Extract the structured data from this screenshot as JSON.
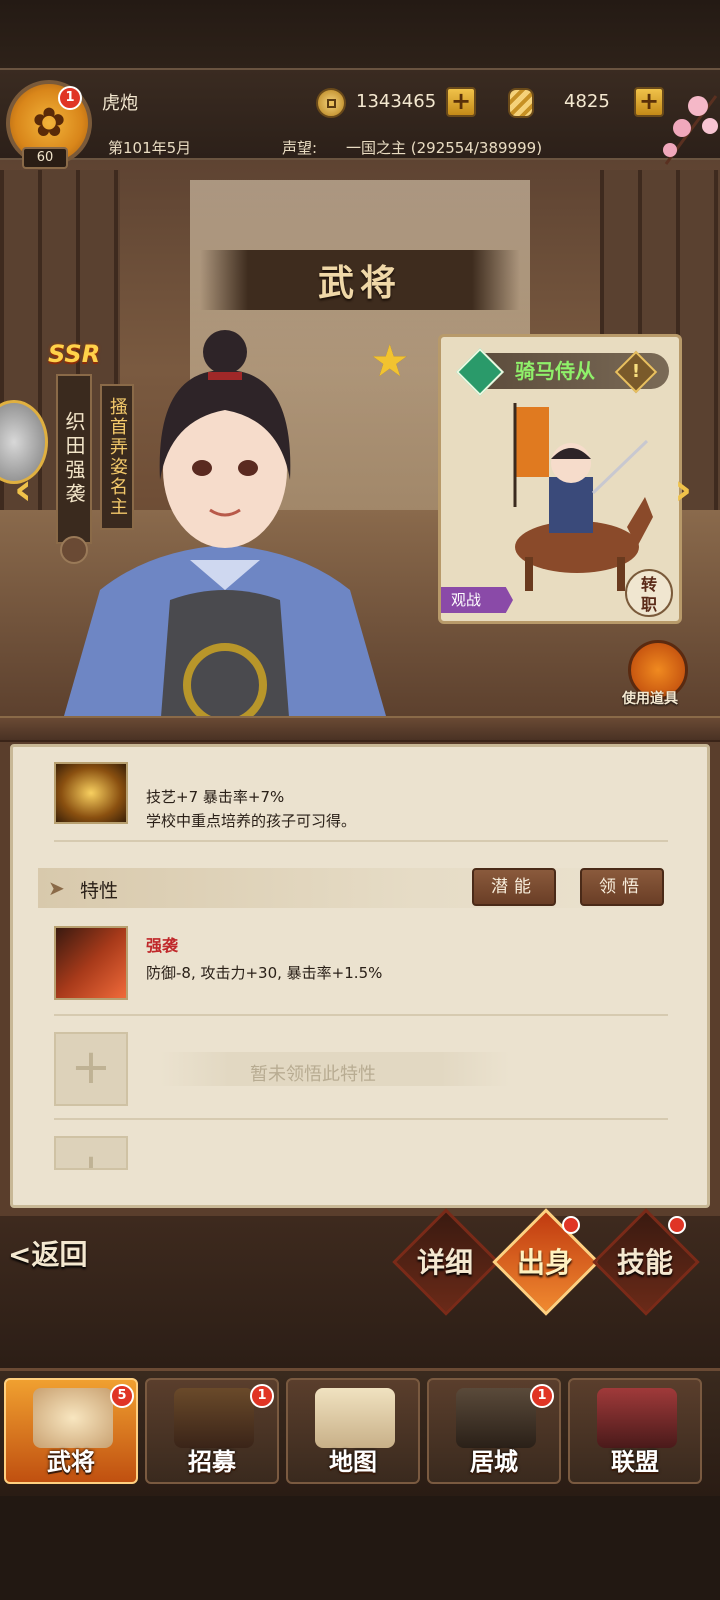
{
  "player": {
    "name": "虎炮",
    "level": "60",
    "notification_count": "1",
    "date": "第101年5月",
    "reputation_label": "声望:",
    "reputation_value": "一国之主 (292554/389999)"
  },
  "currency": {
    "copper": "1343465",
    "gold": "4825"
  },
  "page_title": "武将",
  "general": {
    "rarity": "SSR",
    "name": "织田强袭",
    "title": "搔首弄姿名主"
  },
  "unit": {
    "name": "骑马侍从",
    "spectate_tag": "观战",
    "transfer_label": "转职"
  },
  "use_item_label": "使用道具",
  "skill": {
    "stats": "技艺+7  暴击率+7%",
    "description": "学校中重点培养的孩子可习得。"
  },
  "traits": {
    "section_label": "特性",
    "potential_button": "潜能",
    "comprehend_button": "领悟",
    "items": [
      {
        "name": "强袭",
        "effect": "防御-8, 攻击力+30, 暴击率+1.5%"
      }
    ],
    "empty_label": "暂未领悟此特性"
  },
  "actions": {
    "back": "<返回",
    "tabs": [
      {
        "label": "详细",
        "active": false,
        "badge": false
      },
      {
        "label": "出身",
        "active": true,
        "badge": true
      },
      {
        "label": "技能",
        "active": false,
        "badge": true
      }
    ]
  },
  "nav": [
    {
      "label": "武将",
      "badge": "5",
      "active": true
    },
    {
      "label": "招募",
      "badge": "1",
      "active": false
    },
    {
      "label": "地图",
      "badge": "",
      "active": false
    },
    {
      "label": "居城",
      "badge": "1",
      "active": false
    },
    {
      "label": "联盟",
      "badge": "",
      "active": false
    }
  ],
  "colors": {
    "accent_gold": "#f0c24a",
    "badge_red": "#e03525",
    "trait_red": "#c0282a",
    "unit_green": "#8ff06a"
  }
}
